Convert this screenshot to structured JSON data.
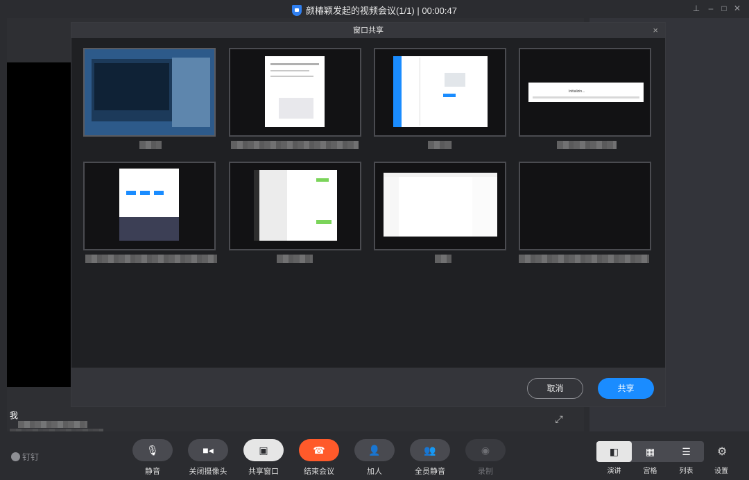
{
  "window": {
    "title": "颜椿颖发起的视频会议(1/1) | 00:00:47",
    "controls": [
      "pin-icon",
      "minimize-icon",
      "maximize-icon",
      "close-icon"
    ]
  },
  "participant": {
    "self_label": "我"
  },
  "dialog": {
    "title": "窗口共享",
    "close": "×",
    "cancel_label": "取消",
    "share_label": "共享",
    "windows": [
      {
        "selected": true
      },
      {
        "selected": false
      },
      {
        "selected": false
      },
      {
        "selected": false,
        "content": "Initializin..."
      },
      {
        "selected": false
      },
      {
        "selected": false
      },
      {
        "selected": false
      },
      {
        "selected": false
      }
    ]
  },
  "toolbar": {
    "brand": "钉钉",
    "buttons": [
      {
        "id": "mute",
        "label": "静音",
        "icon": "microphone-icon"
      },
      {
        "id": "camera",
        "label": "关闭摄像头",
        "icon": "camera-icon"
      },
      {
        "id": "share",
        "label": "共享窗口",
        "icon": "screen-share-icon"
      },
      {
        "id": "end",
        "label": "结束会议",
        "icon": "hangup-icon"
      },
      {
        "id": "invite",
        "label": "加人",
        "icon": "add-person-icon"
      },
      {
        "id": "mute-all",
        "label": "全员静音",
        "icon": "mute-all-icon"
      },
      {
        "id": "record",
        "label": "录制",
        "icon": "record-icon"
      }
    ],
    "layouts": [
      {
        "label": "演讲",
        "icon": "speaker-layout-icon",
        "active": true
      },
      {
        "label": "宫格",
        "icon": "grid-layout-icon",
        "active": false
      },
      {
        "label": "列表",
        "icon": "list-layout-icon",
        "active": false
      }
    ],
    "settings_label": "设置"
  },
  "colors": {
    "accent": "#1a8cff",
    "end_call": "#ff5a2a",
    "background": "#2b2c30"
  }
}
